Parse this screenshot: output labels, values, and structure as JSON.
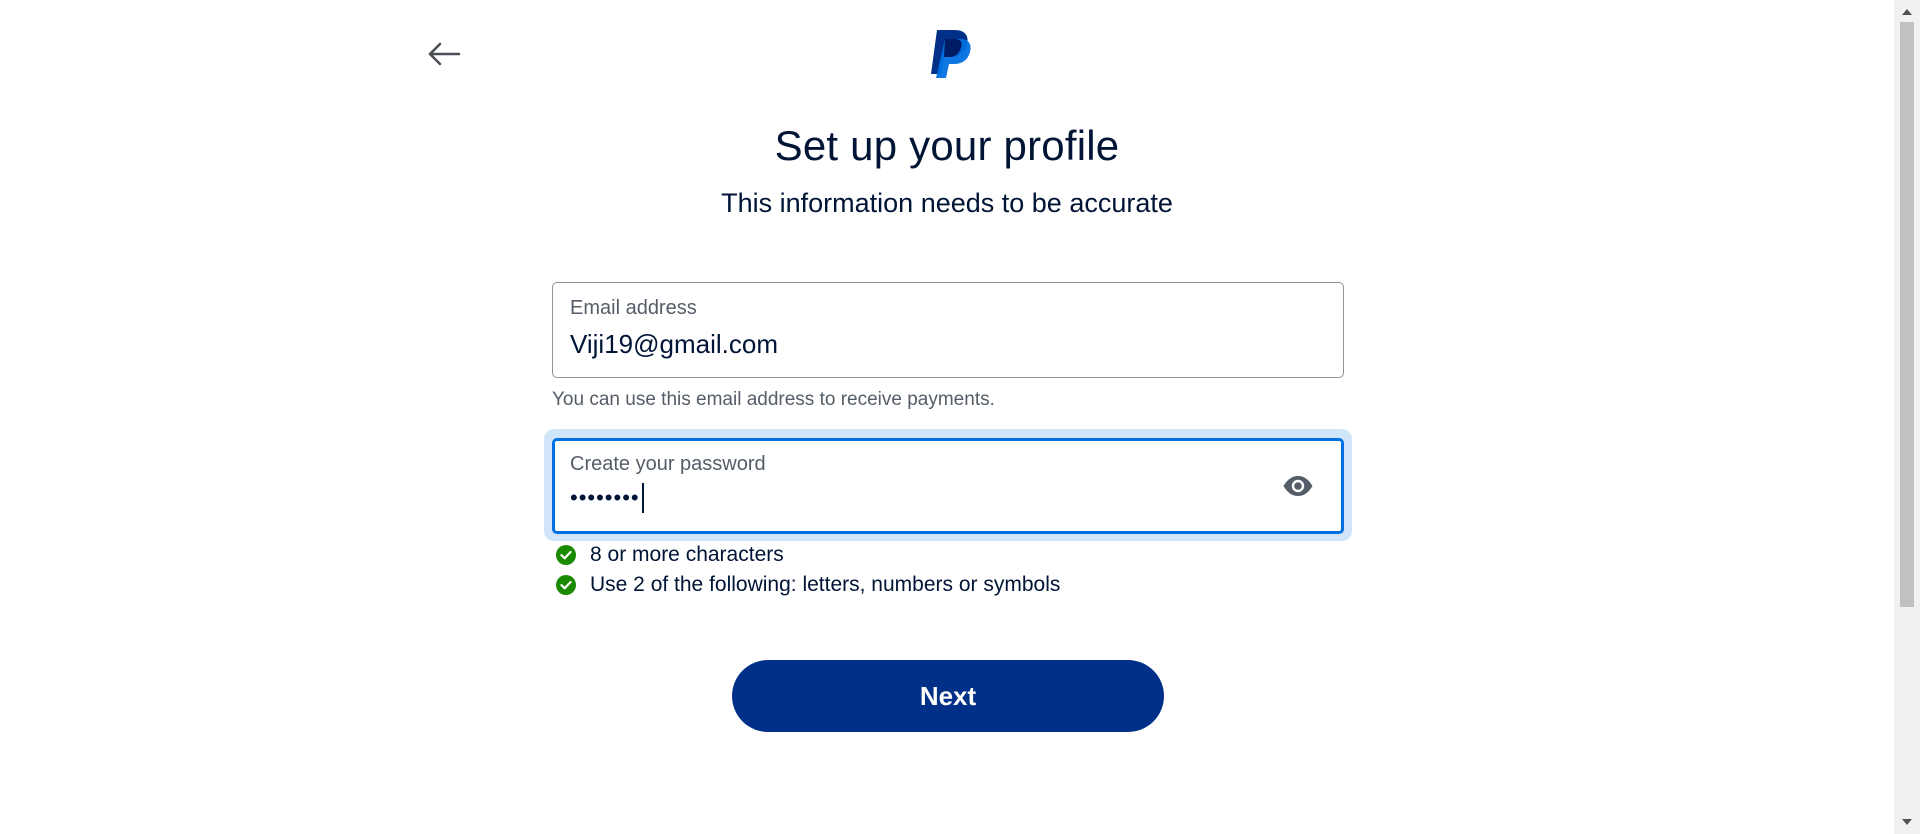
{
  "header": {
    "back_icon": "arrow-left-icon",
    "logo": "paypal-logo"
  },
  "title": "Set up your profile",
  "subtitle": "This information needs to be accurate",
  "email": {
    "label": "Email address",
    "value": "Viji19@gmail.com",
    "help_text": "You can use this email address to receive payments."
  },
  "password": {
    "label": "Create your password",
    "masked_value": "••••••••",
    "toggle_icon": "eye-icon"
  },
  "requirements": [
    {
      "text": "8 or more characters",
      "met": true
    },
    {
      "text": "Use 2 of the following: letters, numbers or symbols",
      "met": true
    }
  ],
  "next_label": "Next",
  "colors": {
    "brand_primary": "#003087",
    "focus_blue": "#0070e0",
    "success_green": "#1a8a00",
    "text_dark": "#001435"
  }
}
